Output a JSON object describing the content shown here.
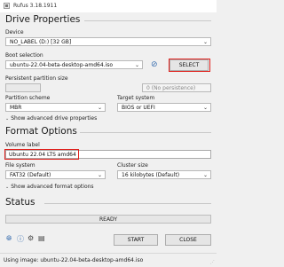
{
  "window": {
    "title": "Rufus 3.18.1911"
  },
  "drive_properties": {
    "heading": "Drive Properties",
    "device_label": "Device",
    "device_value": "NO_LABEL (D:) [32 GB]",
    "boot_selection_label": "Boot selection",
    "boot_selection_value": "ubuntu-22.04-beta-desktop-amd64.iso",
    "select_button": "SELECT",
    "persistent_label": "Persistent partition size",
    "persistent_value": "0 (No persistence)",
    "partition_scheme_label": "Partition scheme",
    "partition_scheme_value": "MBR",
    "target_system_label": "Target system",
    "target_system_value": "BIOS or UEFI",
    "advanced_toggle": "Show advanced drive properties"
  },
  "format_options": {
    "heading": "Format Options",
    "volume_label_label": "Volume label",
    "volume_label_value": "Ubuntu 22.04 LTS amd64",
    "file_system_label": "File system",
    "file_system_value": "FAT32 (Default)",
    "cluster_size_label": "Cluster size",
    "cluster_size_value": "16 kilobytes (Default)",
    "advanced_toggle": "Show advanced format options"
  },
  "status": {
    "heading": "Status",
    "progress_text": "READY",
    "start_button": "START",
    "close_button": "CLOSE"
  },
  "status_bar": {
    "text": "Using image: ubuntu-22.04-beta-desktop-amd64.iso"
  },
  "icons": [
    "globe-icon",
    "info-icon",
    "settings-icon",
    "log-icon",
    "check-icon"
  ],
  "colors": {
    "highlight": "#e0201c",
    "accent": "#3a6fb0"
  }
}
